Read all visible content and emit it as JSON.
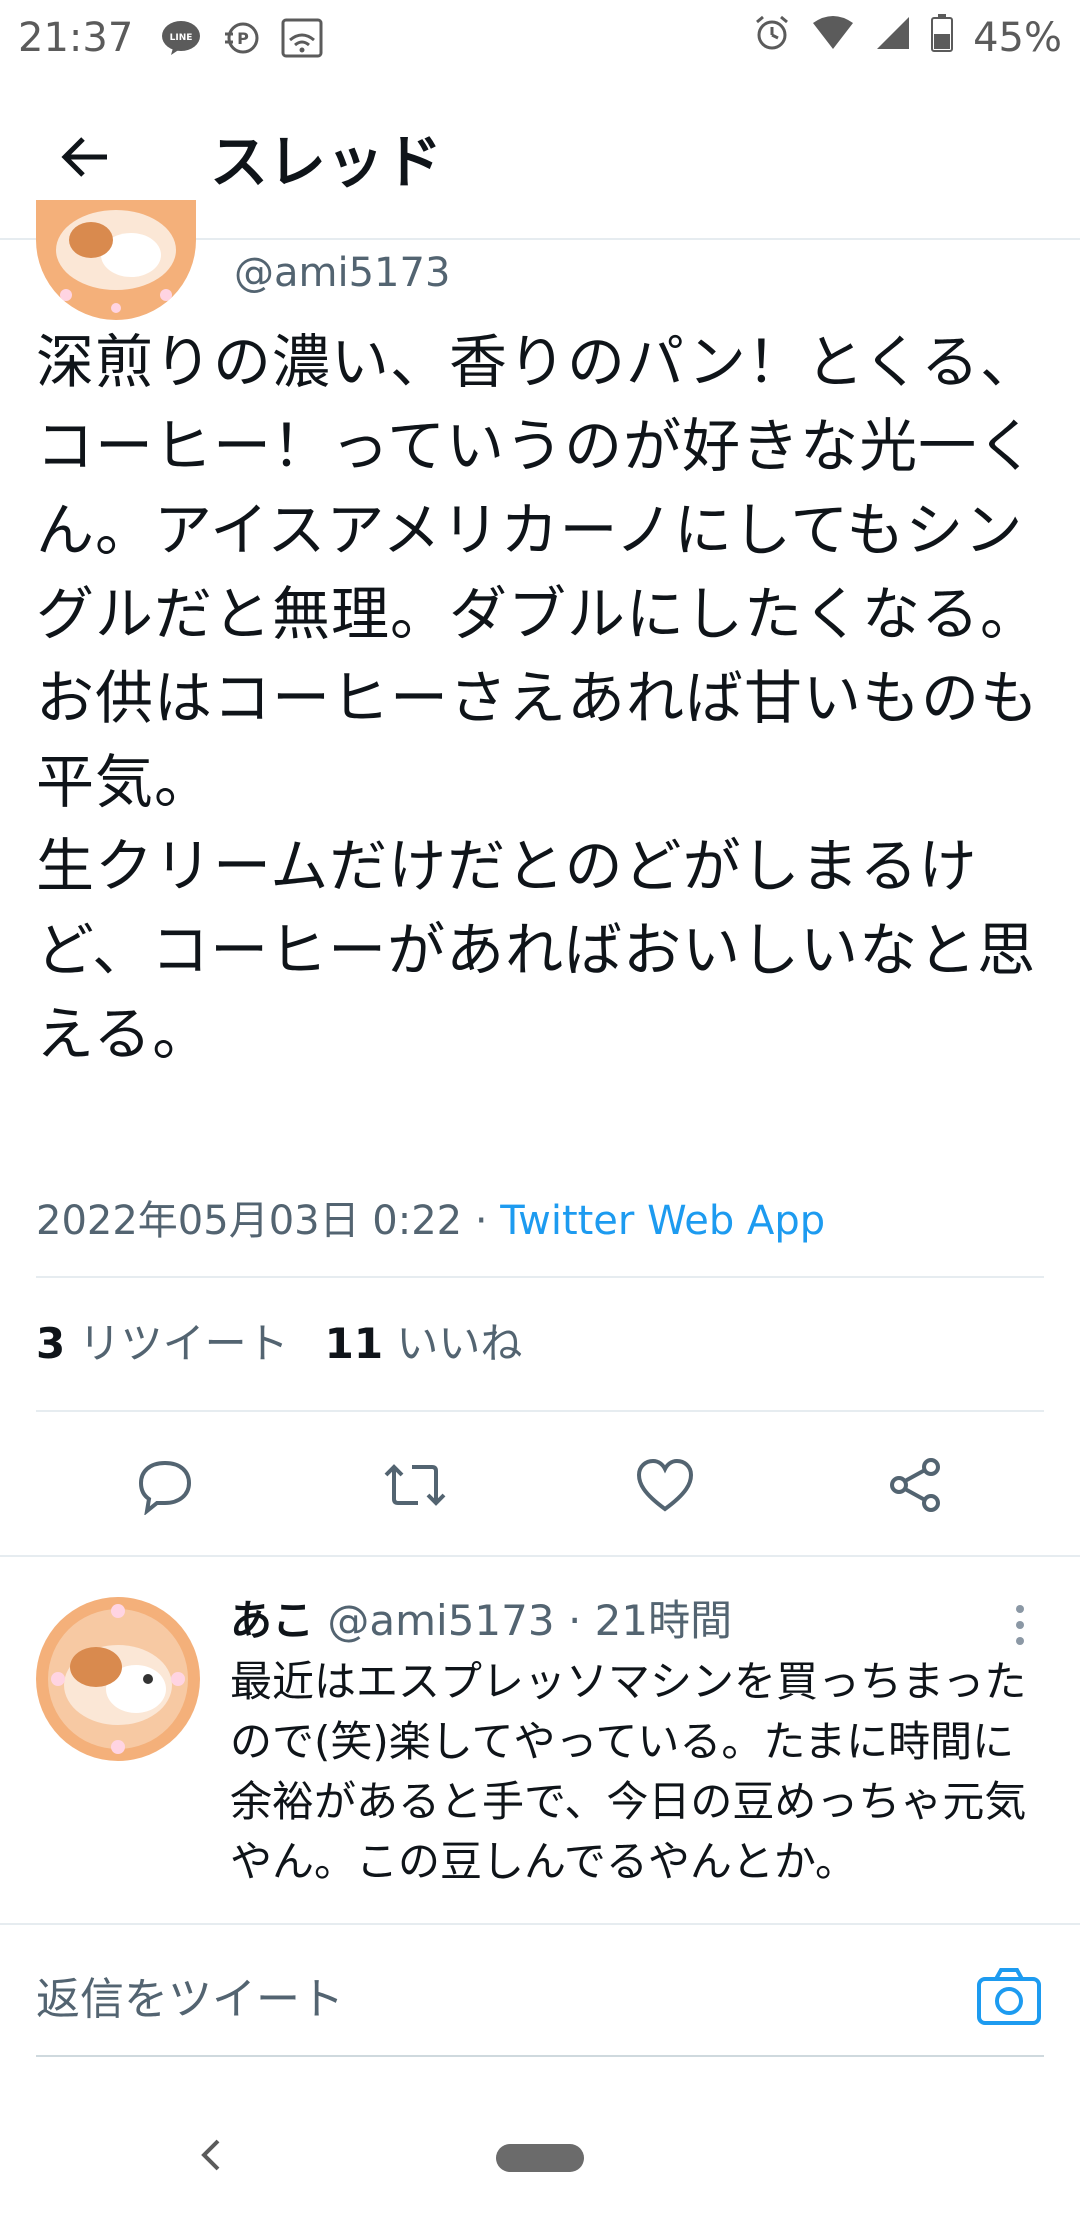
{
  "status_bar": {
    "time": "21:37",
    "line_icon_text": "LINE",
    "battery": "45%"
  },
  "header": {
    "title": "スレッド"
  },
  "tweet": {
    "handle": "@ami5173",
    "text": "深煎りの濃い、香りのパン！とくる、コーヒー！っていうのが好きな光一くん。アイスアメリカーノにしてもシングルだと無理。ダブルにしたくなる。\nお供はコーヒーさえあれば甘いものも平気。\n生クリームだけだとのどがしまるけど、コーヒーがあればおいしいなと思える。",
    "timestamp": "2022年05月03日 0:22",
    "separator": "·",
    "app": "Twitter Web App",
    "retweets_count": "3",
    "retweets_label": "リツイート",
    "likes_count": "11",
    "likes_label": "いいね"
  },
  "reply": {
    "name": "あこ",
    "handle": "@ami5173",
    "separator": "·",
    "time": "21時間",
    "text": "最近はエスプレッソマシンを買っちまったので(笑)楽してやっている。たまに時間に余裕があると手で、今日の豆めっちゃ元気やん。この豆しんでるやんとか。"
  },
  "compose": {
    "placeholder": "返信をツイート"
  },
  "colors": {
    "accent": "#1d9bf0",
    "text": "#0f1419",
    "muted": "#536471",
    "divider": "#e6ecf0"
  }
}
